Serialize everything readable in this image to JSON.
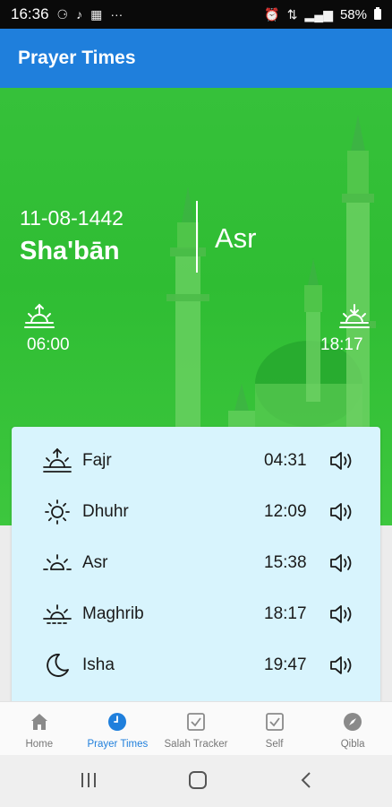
{
  "status_bar": {
    "time": "16:36",
    "battery": "58%",
    "icons": [
      "sync-icon",
      "tiktok-icon",
      "news-icon",
      "more-icon",
      "alarm-icon",
      "data-icon",
      "signal-icon",
      "signal-icon",
      "battery-icon"
    ]
  },
  "app_bar": {
    "title": "Prayer Times"
  },
  "hero": {
    "hijri_date": "11-08-1442",
    "hijri_month": "Sha'bān",
    "current_prayer": "Asr",
    "sunrise_time": "06:00",
    "sunset_time": "18:17",
    "background_color": "#36c13a"
  },
  "prayers": [
    {
      "name": "Fajr",
      "time": "04:31",
      "icon": "fajr-icon"
    },
    {
      "name": "Dhuhr",
      "time": "12:09",
      "icon": "dhuhr-icon"
    },
    {
      "name": "Asr",
      "time": "15:38",
      "icon": "asr-icon"
    },
    {
      "name": "Maghrib",
      "time": "18:17",
      "icon": "maghrib-icon"
    },
    {
      "name": "Isha",
      "time": "19:47",
      "icon": "isha-icon"
    }
  ],
  "bottom_nav": {
    "items": [
      {
        "label": "Home",
        "icon": "home-icon",
        "active": false
      },
      {
        "label": "Prayer Times",
        "icon": "clock-icon",
        "active": true
      },
      {
        "label": "Salah Tracker",
        "icon": "checkbox-icon",
        "active": false
      },
      {
        "label": "Self",
        "icon": "checkbox-icon",
        "active": false
      },
      {
        "label": "Qibla",
        "icon": "compass-icon",
        "active": false
      }
    ]
  },
  "colors": {
    "accent": "#1f7fdc",
    "card": "#d8f4fd",
    "hero_green": "#36c13a"
  }
}
